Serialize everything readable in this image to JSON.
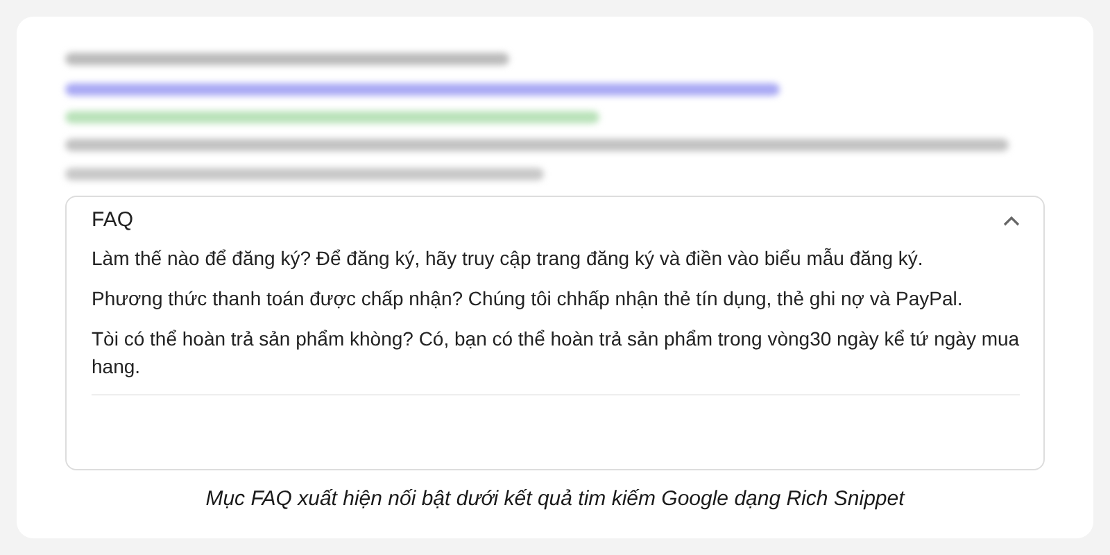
{
  "faq": {
    "title": "FAQ",
    "expanded": true,
    "items": [
      {
        "text": "Làm thế nào để đăng ký? Để đăng ký, hãy truy cập trang đăng ký và điền vào biểu mẫu đăng ký."
      },
      {
        "text": "Phương thức thanh toán được chấp nhận? Chúng tôi chhấp nhận thẻ tín dụng, thẻ ghi nợ và PayPal."
      },
      {
        "text": "Tòi có thể hoàn trả sản phẩm khòng? Có, bạn có thể hoàn trả sản phẩm trong vòng30 ngày kể tứ ngày mua hang."
      }
    ]
  },
  "caption": "Mục FAQ xuất hiện nối bật dưới kết quả tim kiếm Google dạng Rich Snippet"
}
